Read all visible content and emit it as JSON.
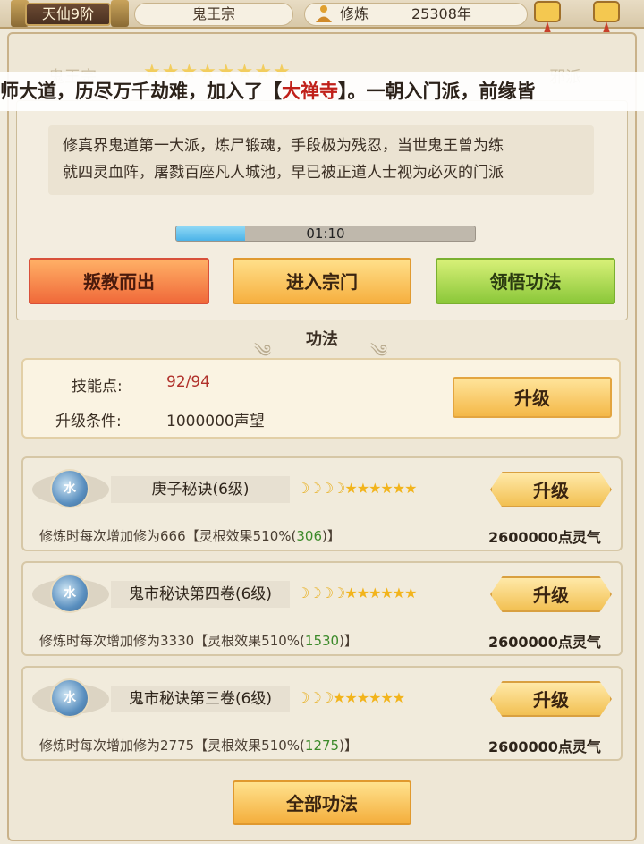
{
  "header": {
    "rank": "天仙9阶",
    "sect": "鬼王宗",
    "cultivation_label": "修炼",
    "cultivation_years": "25308年"
  },
  "background_labels": {
    "left": "鬼王宗",
    "right": "邪派"
  },
  "marquee": {
    "before": "师大道，历尽万千劫难，加入了【",
    "highlight": "大禅寺",
    "after": "】。一朝入门派，前缘皆"
  },
  "description": {
    "line1": "修真界鬼道第一大派，炼尸锻魂，手段极为残忍，当世鬼王曾为练",
    "line2": "就四灵血阵，屠戮百座凡人城池，早已被正道人士视为必灭的门派"
  },
  "progress": {
    "time": "01:10",
    "fraction": 0.23
  },
  "actions": {
    "betray": "叛教而出",
    "enter": "进入宗门",
    "comprehend": "领悟功法"
  },
  "section_title": "功法",
  "skill_points": {
    "label": "技能点:",
    "value": "92/94",
    "cond_label": "升级条件:",
    "cond_value": "1000000声望",
    "upgrade": "升级"
  },
  "techniques": [
    {
      "element": "水",
      "name": "庚子秘诀(6级)",
      "moons": 4,
      "stars": 6,
      "desc_pre": "修炼时每次增加修为666【灵根效果510%(",
      "desc_bonus": "306",
      "desc_post": ")】",
      "cost": "2600000点灵气",
      "upgrade": "升级"
    },
    {
      "element": "水",
      "name": "鬼市秘诀第四卷(6级)",
      "moons": 4,
      "stars": 6,
      "desc_pre": "修炼时每次增加修为3330【灵根效果510%(",
      "desc_bonus": "1530",
      "desc_post": ")】",
      "cost": "2600000点灵气",
      "upgrade": "升级"
    },
    {
      "element": "水",
      "name": "鬼市秘诀第三卷(6级)",
      "moons": 3,
      "stars": 6,
      "desc_pre": "修炼时每次增加修为2775【灵根效果510%(",
      "desc_bonus": "1275",
      "desc_post": ")】",
      "cost": "2600000点灵气",
      "upgrade": "升级"
    }
  ],
  "all_techniques": "全部功法",
  "colors": {
    "accent_red": "#c0201a",
    "bonus_green": "#3c8a2a",
    "skill_value": "#b0302a"
  }
}
